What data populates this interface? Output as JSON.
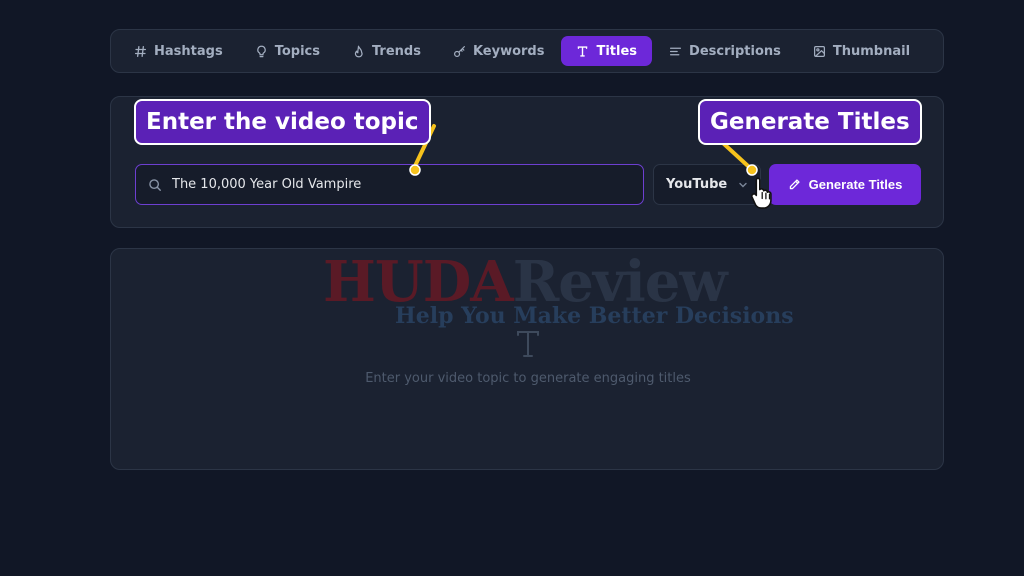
{
  "tabs": [
    {
      "label": "Hashtags",
      "icon": "hash-icon",
      "active": false
    },
    {
      "label": "Topics",
      "icon": "lightbulb-icon",
      "active": false
    },
    {
      "label": "Trends",
      "icon": "flame-icon",
      "active": false
    },
    {
      "label": "Keywords",
      "icon": "key-icon",
      "active": false
    },
    {
      "label": "Titles",
      "icon": "type-icon",
      "active": true
    },
    {
      "label": "Descriptions",
      "icon": "align-left-icon",
      "active": false
    },
    {
      "label": "Thumbnail",
      "icon": "image-icon",
      "active": false
    }
  ],
  "input": {
    "value": "The 10,000 Year Old Vampire",
    "icon": "search-icon"
  },
  "platform": {
    "selected": "YouTube",
    "icon": "chevron-down-icon"
  },
  "generate_button": {
    "label": "Generate Titles",
    "icon": "pencil-icon"
  },
  "results": {
    "empty_icon": "type-icon",
    "empty_text": "Enter your video topic to generate engaging titles"
  },
  "watermark": {
    "brand_part1": "HUDA",
    "brand_part2": "Review",
    "slogan": "Help You Make Better Decisions"
  },
  "annotations": {
    "callout_topic": "Enter the video topic",
    "callout_generate": "Generate Titles",
    "pointer_icon": "hand-pointer-icon"
  },
  "colors": {
    "background": "#111726",
    "panel": "#1b2231",
    "accent": "#6d28d9",
    "callout_arrow": "#f6c21c"
  }
}
